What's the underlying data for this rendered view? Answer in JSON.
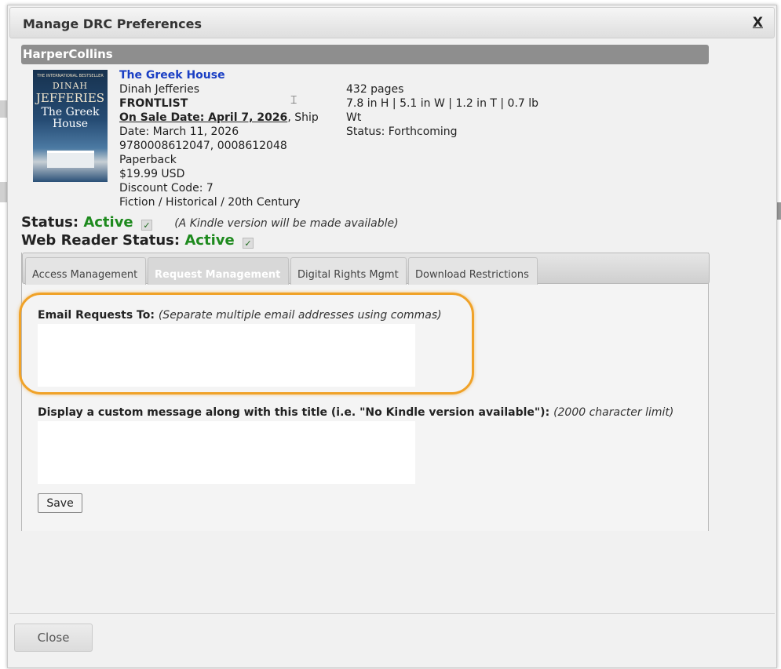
{
  "dialog": {
    "title": "Manage DRC Preferences",
    "close_x": "X",
    "close_button": "Close"
  },
  "publisher": "HarperCollins",
  "cover": {
    "kicker": "THE INTERNATIONAL BESTSELLER",
    "author_first": "DINAH",
    "author_last": "JEFFERIES",
    "title": "The Greek House"
  },
  "book": {
    "title": "The Greek House",
    "author": "Dinah Jefferies",
    "list": "FRONTLIST",
    "on_sale_label": "On Sale Date: April 7, 2026",
    "ship_date": ", Ship Date: March 11, 2026",
    "isbns": "9780008612047, 0008612048",
    "format": "Paperback",
    "price": "$19.99 USD",
    "discount": "Discount Code: 7",
    "category": "Fiction / Historical / 20th Century",
    "pages": "432 pages",
    "dimensions": "7.8 in H | 5.1 in W | 1.2 in T | 0.7 lb Wt",
    "status": "Status: Forthcoming"
  },
  "status": {
    "label": "Status:",
    "value": "Active",
    "kindle_note": "(A Kindle version will be made available)",
    "web_label": "Web Reader Status:",
    "web_value": "Active"
  },
  "tabs": [
    {
      "label": "Access Management"
    },
    {
      "label": "Request Management"
    },
    {
      "label": "Digital Rights Mgmt"
    },
    {
      "label": "Download Restrictions"
    }
  ],
  "form": {
    "email_label": "Email Requests To:",
    "email_hint": "(Separate multiple email addresses using commas)",
    "email_value": "",
    "message_label": "Display a custom message along with this title (i.e. \"No Kindle version available\"):",
    "message_hint": "(2000 character limit)",
    "message_value": "",
    "save": "Save"
  },
  "colors": {
    "active": "#1e8a1e",
    "link": "#1a3fc4",
    "highlight": "#f0a228",
    "publisher_bar": "#8e8e8e"
  },
  "icons": [
    "check-icon",
    "text-cursor-icon"
  ]
}
